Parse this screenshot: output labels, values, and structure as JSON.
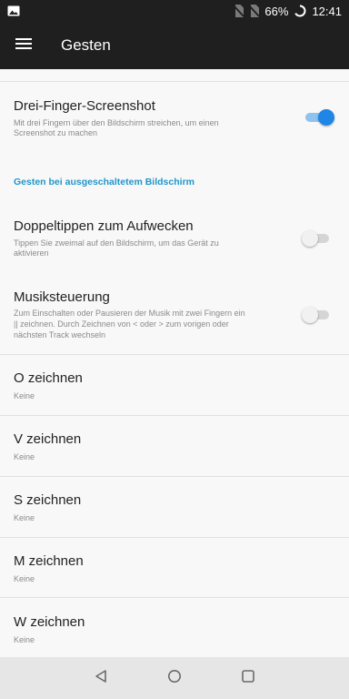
{
  "status_bar": {
    "battery": "66%",
    "time": "12:41",
    "icons": [
      "image-icon",
      "no-sim-icon",
      "no-sim-icon",
      "battery-icon"
    ]
  },
  "app_bar": {
    "title": "Gesten",
    "menu_icon": "menu-icon"
  },
  "settings": {
    "three_finger": {
      "title": "Drei-Finger-Screenshot",
      "subtitle_1": "Mit drei Fingern über den Bildschirm streichen, um einen",
      "subtitle_2": "Screenshot zu machen",
      "enabled": true
    },
    "section_header": "Gesten bei ausgeschaltetem Bildschirm",
    "double_tap": {
      "title": "Doppeltippen zum Aufwecken",
      "subtitle_1": "Tippen Sie zweimal auf den Bildschirm, um das Gerät zu",
      "subtitle_2": "aktivieren",
      "enabled": false
    },
    "music": {
      "title": "Musiksteuerung",
      "subtitle_1": "Zum Einschalten oder Pausieren der Musik mit zwei Fingern ein",
      "subtitle_2": "|| zeichnen. Durch Zeichnen von < oder > zum vorigen oder",
      "subtitle_3": "nächsten Track wechseln",
      "enabled": false
    },
    "draw_items": [
      {
        "title": "O zeichnen",
        "value": "Keine"
      },
      {
        "title": "V zeichnen",
        "value": "Keine"
      },
      {
        "title": "S zeichnen",
        "value": "Keine"
      },
      {
        "title": "M zeichnen",
        "value": "Keine"
      },
      {
        "title": "W zeichnen",
        "value": "Keine"
      }
    ]
  },
  "colors": {
    "accent": "#2096c9",
    "toggle_on": "#1f86e6",
    "app_bar": "#1f1f1f"
  }
}
